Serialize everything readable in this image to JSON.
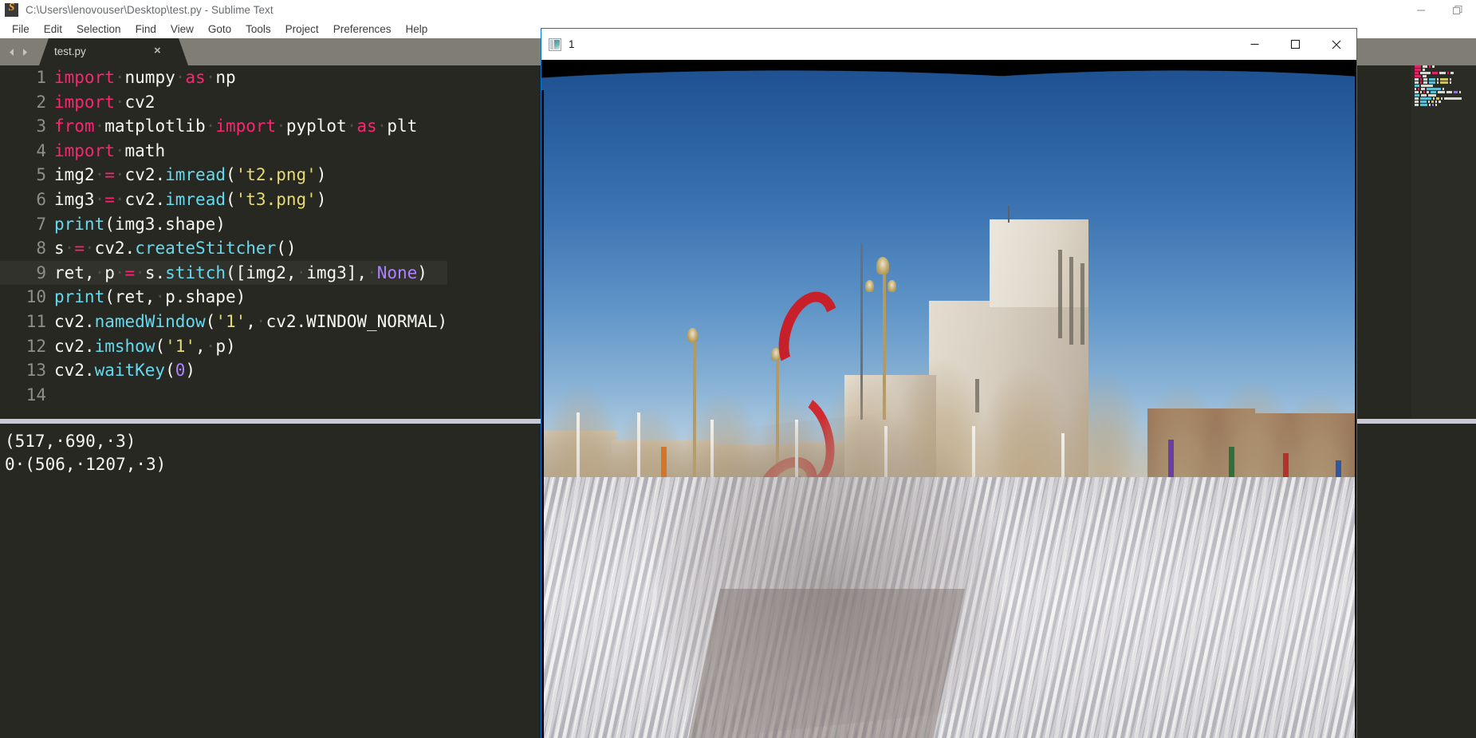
{
  "sublime": {
    "title": "C:\\Users\\lenovouser\\Desktop\\test.py - Sublime Text",
    "logo_icon": "sublime-logo-icon",
    "window_buttons": [
      {
        "name": "minimize-button",
        "icon": "minimize-icon"
      },
      {
        "name": "restore-button",
        "icon": "restore-icon"
      }
    ],
    "menu": [
      "File",
      "Edit",
      "Selection",
      "Find",
      "View",
      "Goto",
      "Tools",
      "Project",
      "Preferences",
      "Help"
    ],
    "tab": {
      "label": "test.py",
      "close_label": "×",
      "prev_icon": "chevron-left-icon",
      "next_icon": "chevron-right-icon"
    },
    "code": {
      "current_line": 9,
      "lines": [
        {
          "n": "1",
          "tokens": [
            {
              "t": "import",
              "c": "kw"
            },
            {
              "t": "·",
              "c": "dot"
            },
            {
              "t": "numpy",
              "c": "def"
            },
            {
              "t": "·",
              "c": "dot"
            },
            {
              "t": "as",
              "c": "kw"
            },
            {
              "t": "·",
              "c": "dot"
            },
            {
              "t": "np",
              "c": "def"
            }
          ]
        },
        {
          "n": "2",
          "tokens": [
            {
              "t": "import",
              "c": "kw"
            },
            {
              "t": "·",
              "c": "dot"
            },
            {
              "t": "cv2",
              "c": "def"
            }
          ]
        },
        {
          "n": "3",
          "tokens": [
            {
              "t": "from",
              "c": "kw"
            },
            {
              "t": "·",
              "c": "dot"
            },
            {
              "t": "matplotlib",
              "c": "def"
            },
            {
              "t": "·",
              "c": "dot"
            },
            {
              "t": "import",
              "c": "kw"
            },
            {
              "t": "·",
              "c": "dot"
            },
            {
              "t": "pyplot",
              "c": "def"
            },
            {
              "t": "·",
              "c": "dot"
            },
            {
              "t": "as",
              "c": "kw"
            },
            {
              "t": "·",
              "c": "dot"
            },
            {
              "t": "plt",
              "c": "def"
            }
          ]
        },
        {
          "n": "4",
          "tokens": [
            {
              "t": "import",
              "c": "kw"
            },
            {
              "t": "·",
              "c": "dot"
            },
            {
              "t": "math",
              "c": "def"
            }
          ]
        },
        {
          "n": "5",
          "tokens": [
            {
              "t": "img2",
              "c": "def"
            },
            {
              "t": "·",
              "c": "dot"
            },
            {
              "t": "=",
              "c": "kw"
            },
            {
              "t": "·",
              "c": "dot"
            },
            {
              "t": "cv2.",
              "c": "def"
            },
            {
              "t": "imread",
              "c": "fn"
            },
            {
              "t": "(",
              "c": "def"
            },
            {
              "t": "'t2.png'",
              "c": "str"
            },
            {
              "t": ")",
              "c": "def"
            }
          ]
        },
        {
          "n": "6",
          "tokens": [
            {
              "t": "img3",
              "c": "def"
            },
            {
              "t": "·",
              "c": "dot"
            },
            {
              "t": "=",
              "c": "kw"
            },
            {
              "t": "·",
              "c": "dot"
            },
            {
              "t": "cv2.",
              "c": "def"
            },
            {
              "t": "imread",
              "c": "fn"
            },
            {
              "t": "(",
              "c": "def"
            },
            {
              "t": "'t3.png'",
              "c": "str"
            },
            {
              "t": ")",
              "c": "def"
            }
          ]
        },
        {
          "n": "7",
          "tokens": [
            {
              "t": "print",
              "c": "fn"
            },
            {
              "t": "(img3.shape)",
              "c": "def"
            }
          ]
        },
        {
          "n": "8",
          "tokens": [
            {
              "t": "s",
              "c": "def"
            },
            {
              "t": "·",
              "c": "dot"
            },
            {
              "t": "=",
              "c": "kw"
            },
            {
              "t": "·",
              "c": "dot"
            },
            {
              "t": "cv2.",
              "c": "def"
            },
            {
              "t": "createStitcher",
              "c": "fn"
            },
            {
              "t": "()",
              "c": "def"
            }
          ]
        },
        {
          "n": "9",
          "tokens": [
            {
              "t": "ret,",
              "c": "def"
            },
            {
              "t": "·",
              "c": "dot"
            },
            {
              "t": "p",
              "c": "def"
            },
            {
              "t": "·",
              "c": "dot"
            },
            {
              "t": "=",
              "c": "kw"
            },
            {
              "t": "·",
              "c": "dot"
            },
            {
              "t": "s.",
              "c": "def"
            },
            {
              "t": "stitch",
              "c": "fn"
            },
            {
              "t": "([img2,",
              "c": "def"
            },
            {
              "t": "·",
              "c": "dot"
            },
            {
              "t": "img3],",
              "c": "def"
            },
            {
              "t": "·",
              "c": "dot"
            },
            {
              "t": "None",
              "c": "num"
            },
            {
              "t": ")",
              "c": "def"
            }
          ]
        },
        {
          "n": "10",
          "tokens": [
            {
              "t": "print",
              "c": "fn"
            },
            {
              "t": "(ret,",
              "c": "def"
            },
            {
              "t": "·",
              "c": "dot"
            },
            {
              "t": "p.shape)",
              "c": "def"
            }
          ]
        },
        {
          "n": "11",
          "tokens": [
            {
              "t": "cv2.",
              "c": "def"
            },
            {
              "t": "namedWindow",
              "c": "fn"
            },
            {
              "t": "(",
              "c": "def"
            },
            {
              "t": "'1'",
              "c": "str"
            },
            {
              "t": ",",
              "c": "def"
            },
            {
              "t": "·",
              "c": "dot"
            },
            {
              "t": "cv2.WINDOW_NORMAL)",
              "c": "def"
            }
          ]
        },
        {
          "n": "12",
          "tokens": [
            {
              "t": "cv2.",
              "c": "def"
            },
            {
              "t": "imshow",
              "c": "fn"
            },
            {
              "t": "(",
              "c": "def"
            },
            {
              "t": "'1'",
              "c": "str"
            },
            {
              "t": ",",
              "c": "def"
            },
            {
              "t": "·",
              "c": "dot"
            },
            {
              "t": "p)",
              "c": "def"
            }
          ]
        },
        {
          "n": "13",
          "tokens": [
            {
              "t": "cv2.",
              "c": "def"
            },
            {
              "t": "waitKey",
              "c": "fn"
            },
            {
              "t": "(",
              "c": "def"
            },
            {
              "t": "0",
              "c": "num"
            },
            {
              "t": ")",
              "c": "def"
            }
          ]
        },
        {
          "n": "14",
          "tokens": []
        }
      ]
    },
    "console": {
      "lines": [
        "(517,·690,·3)",
        "0·(506,·1207,·3)"
      ]
    }
  },
  "cv_window": {
    "title": "1",
    "icon": "image-preview-icon",
    "window_buttons": [
      {
        "name": "minimize-button",
        "icon": "minimize-icon"
      },
      {
        "name": "maximize-button",
        "icon": "maximize-icon"
      },
      {
        "name": "close-button",
        "icon": "close-icon"
      }
    ],
    "image": {
      "description": "Stitched panorama of a snow-covered plaza with bare winter trees, flagpoles, a red ribbon sculpture and a tall concrete office building under a clear blue sky; black wedges remain at the top from the stitching warp.",
      "sky_color": "#2a61a0",
      "snow_color": "#d9d7da",
      "sculpture_color": "#c8202a",
      "building_color": "#d7cec0",
      "border_color": "#000000"
    }
  },
  "colors": {
    "editor_bg": "#272822",
    "keyword": "#f92672",
    "function": "#66d9ef",
    "string": "#e6db74",
    "number": "#ae81ff",
    "default_text": "#f8f8f2",
    "line_number": "#8e8f87",
    "tabbar_bg": "#807d74",
    "window_accent": "#0078d7"
  }
}
